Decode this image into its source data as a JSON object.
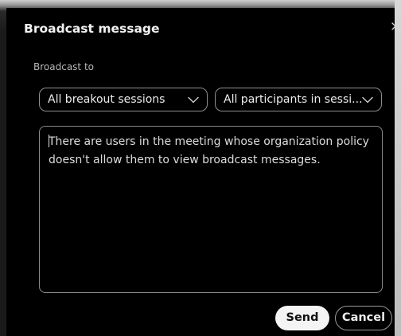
{
  "dialog": {
    "title": "Broadcast message",
    "close_icon": "close-icon"
  },
  "broadcast": {
    "label": "Broadcast to",
    "sessions_select": {
      "value": "All breakout sessions",
      "icon": "chevron-down-icon"
    },
    "participants_select": {
      "value": "All participants in sessi...",
      "icon": "chevron-down-icon"
    }
  },
  "message": {
    "text": "There are users in the meeting whose organization policy doesn't allow them to view broadcast messages."
  },
  "actions": {
    "send_label": "Send",
    "cancel_label": "Cancel"
  },
  "colors": {
    "dialog_background": "#000000",
    "send_button": "#f4f4f4",
    "border": "#8f8f8f"
  }
}
